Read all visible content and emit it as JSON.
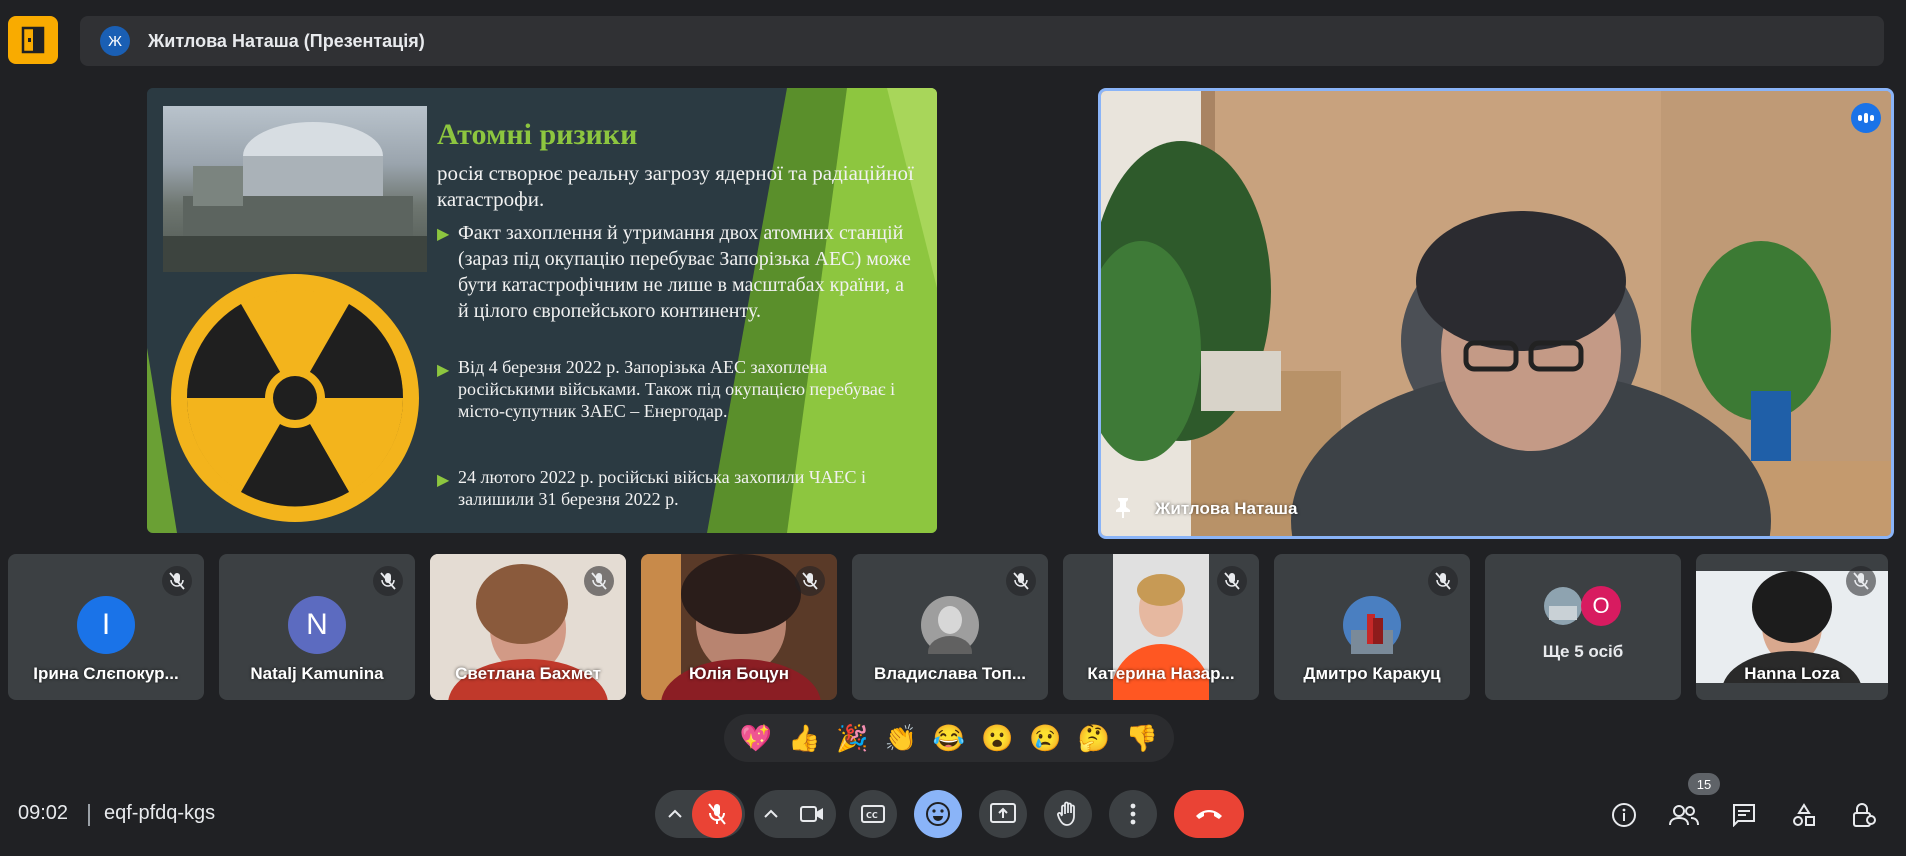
{
  "header": {
    "presenter_initial": "Ж",
    "presentation_title": "Житлова Наташа (Презентація)"
  },
  "slide": {
    "title": "Атомні ризики",
    "intro": "   росія створює  реальну загрозу ядерної та радіаційної катастрофи.",
    "bullets": [
      "     Факт захоплення й утримання двох атомних станцій (зараз під окупацію перебуває Запорізька АЕС) може бути катастрофічним не лише в масштабах країни, а й цілого європейського континенту.",
      "Від 4 березня 2022 р. Запорізька АЕС захоплена російськими військами. Також під окупацією перебуває і місто-супутник ЗАЕС – Енергодар.",
      "24 лютого 2022 р. російські війська захопили ЧАЕС і залишили 31 березня 2022 р."
    ]
  },
  "main_speaker": {
    "name": "Житлова Наташа"
  },
  "participants": [
    {
      "name": "Ірина Слєпокур...",
      "initial": "I",
      "color": "#1a73e8",
      "type": "avatar"
    },
    {
      "name": "Natalj Kamunina",
      "initial": "N",
      "color": "#5c6bc0",
      "type": "avatar"
    },
    {
      "name": "Светлана Бахмет",
      "type": "video"
    },
    {
      "name": "Юлія Боцун",
      "type": "video"
    },
    {
      "name": "Владислава Топ...",
      "type": "photo"
    },
    {
      "name": "Катерина Назар...",
      "type": "video"
    },
    {
      "name": "Дмитро Каракуц",
      "type": "photo"
    },
    {
      "name": "Ще 5 осіб",
      "initial": "O",
      "type": "more"
    },
    {
      "name": "Hanna Loza",
      "type": "video"
    }
  ],
  "reactions": [
    "💖",
    "👍",
    "🎉",
    "👏",
    "😂",
    "😮",
    "😢",
    "🤔",
    "👎"
  ],
  "bottom": {
    "time": "09:02",
    "meeting_code": "eqf-pfdq-kgs",
    "participant_count": "15"
  },
  "colors": {
    "accent": "#8ab4f8",
    "end_call": "#ea4335",
    "mic_off": "#ea4335",
    "emoji_active": "#8ab4f8",
    "logo": "#f9ab00"
  }
}
